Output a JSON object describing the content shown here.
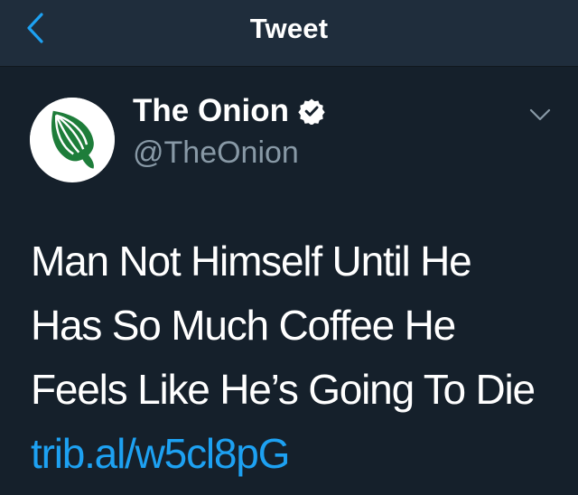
{
  "header": {
    "title": "Tweet",
    "back_icon": "chevron-left-icon"
  },
  "tweet": {
    "author": {
      "display_name": "The Onion",
      "handle": "@TheOnion",
      "verified": true,
      "avatar_icon": "onion-logo-icon"
    },
    "text": "Man Not Himself Until He Has So Much Coffee He Feels Like He’s Going To Die",
    "link": "trib.al/w5cl8pG",
    "menu_icon": "chevron-down-icon"
  },
  "colors": {
    "background": "#15202b",
    "navbar": "#1f2d3c",
    "accent": "#1da1f2",
    "secondary_text": "#8899a6",
    "onion_green": "#1e7d3a"
  }
}
